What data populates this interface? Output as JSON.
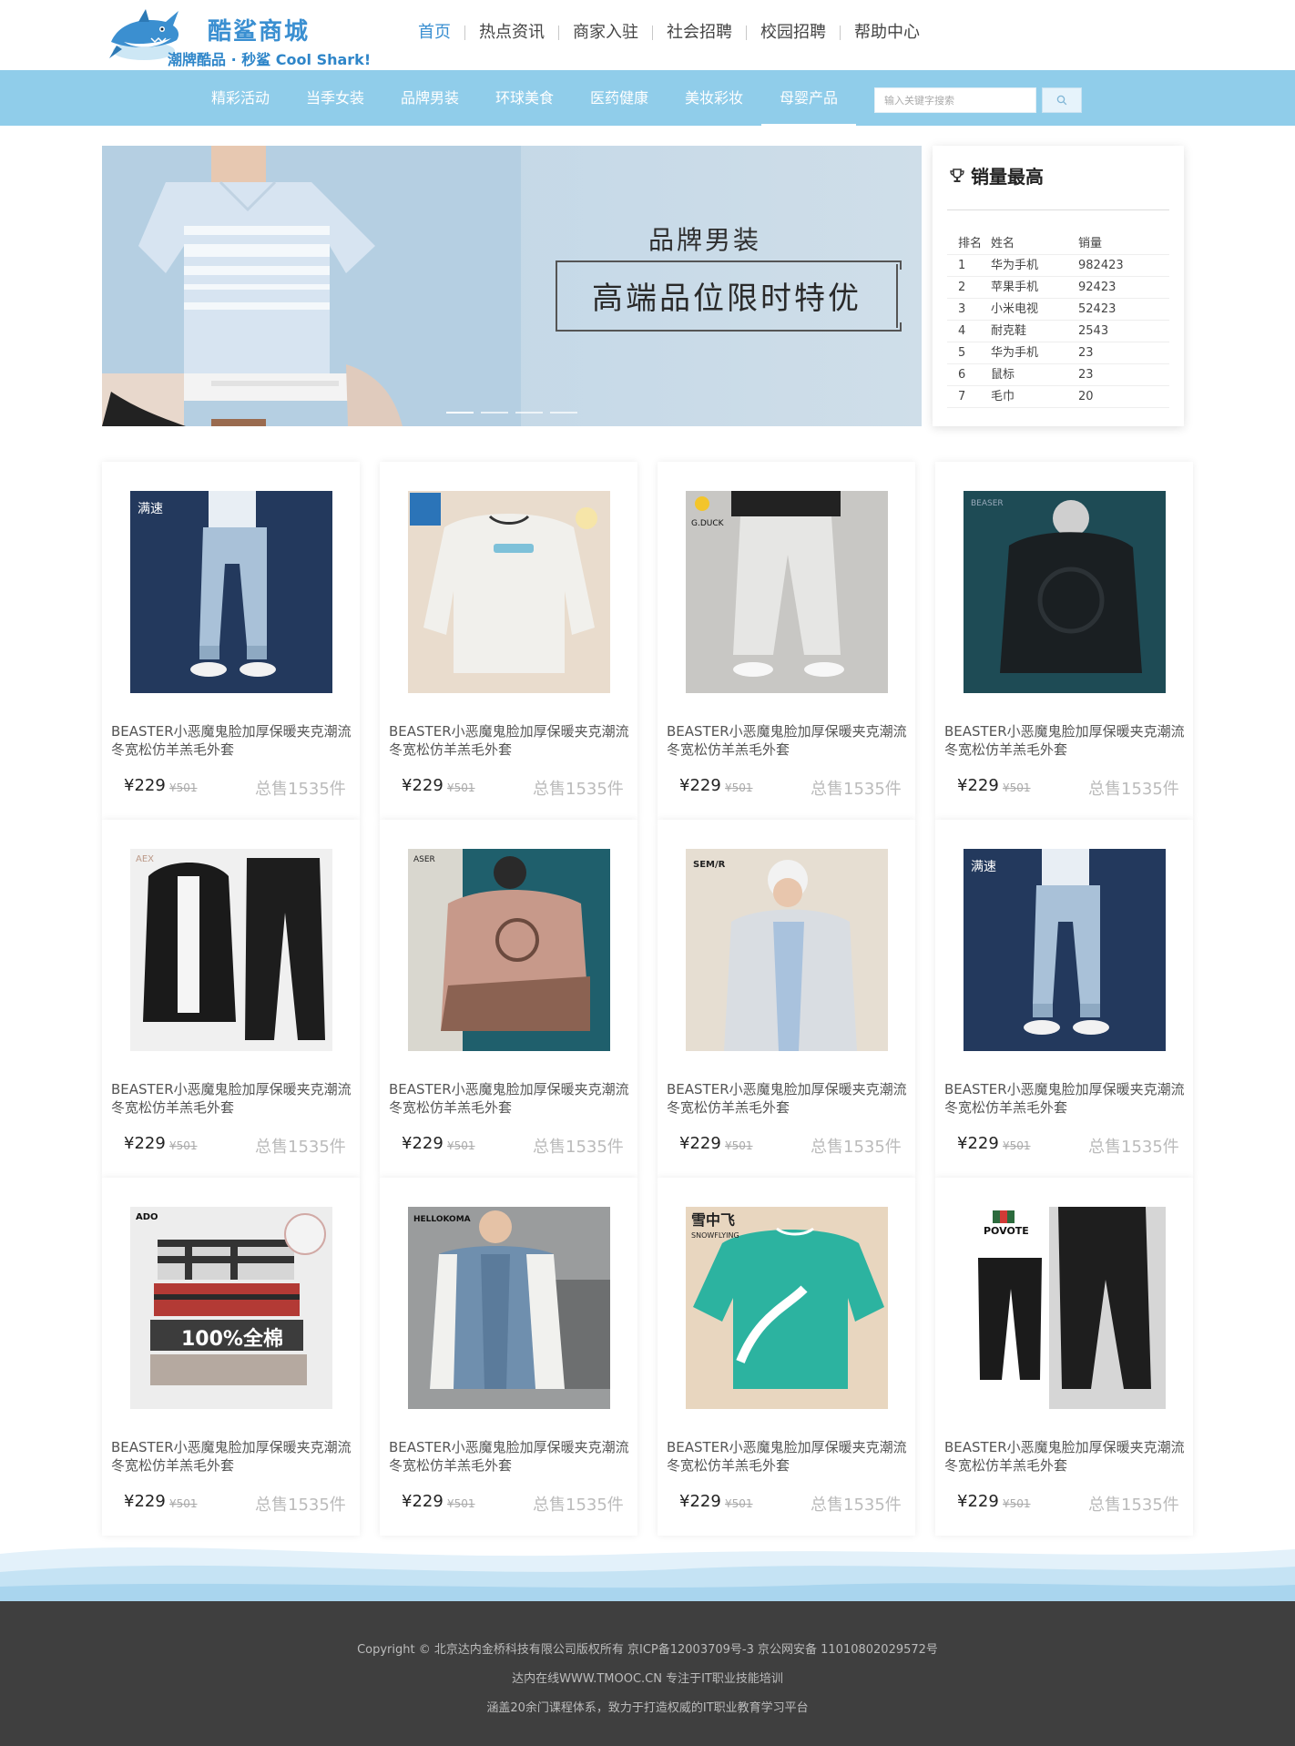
{
  "brand": {
    "name": "酷鲨商城",
    "slogan": "潮牌酷品 · 秒鲨 Cool Shark!"
  },
  "topnav": [
    {
      "label": "首页",
      "active": true
    },
    {
      "label": "热点资讯",
      "active": false
    },
    {
      "label": "商家入驻",
      "active": false
    },
    {
      "label": "社会招聘",
      "active": false
    },
    {
      "label": "校园招聘",
      "active": false
    },
    {
      "label": "帮助中心",
      "active": false
    }
  ],
  "categories": [
    {
      "label": "精彩活动",
      "active": false
    },
    {
      "label": "当季女装",
      "active": false
    },
    {
      "label": "品牌男装",
      "active": false
    },
    {
      "label": "环球美食",
      "active": false
    },
    {
      "label": "医药健康",
      "active": false
    },
    {
      "label": "美妆彩妆",
      "active": false
    },
    {
      "label": "母婴产品",
      "active": true
    }
  ],
  "search": {
    "placeholder": "输入关键字搜索"
  },
  "banner": {
    "title": "品牌男装",
    "subtitle": "高端品位限时特优",
    "slides": 4,
    "active_slide": 0
  },
  "ranking": {
    "title": "销量最高",
    "headers": [
      "排名",
      "姓名",
      "销量"
    ],
    "rows": [
      [
        "1",
        "华为手机",
        "982423"
      ],
      [
        "2",
        "苹果手机",
        "92423"
      ],
      [
        "3",
        "小米电视",
        "52423"
      ],
      [
        "4",
        "耐克鞋",
        "2543"
      ],
      [
        "5",
        "华为手机",
        "23"
      ],
      [
        "6",
        "鼠标",
        "23"
      ],
      [
        "7",
        "毛巾",
        "20"
      ]
    ]
  },
  "products": [
    {
      "name": "BEASTER小恶魔鬼脸加厚保暖夹克潮流冬宽松仿羊羔毛外套",
      "price": "¥229",
      "old_price": "¥501",
      "sold": "总售1535件",
      "image": "jeans-navy",
      "brand_mark": "满速"
    },
    {
      "name": "BEASTER小恶魔鬼脸加厚保暖夹克潮流冬宽松仿羊羔毛外套",
      "price": "¥229",
      "old_price": "¥501",
      "sold": "总售1535件",
      "image": "white-sweatshirt",
      "brand_mark": ""
    },
    {
      "name": "BEASTER小恶魔鬼脸加厚保暖夹克潮流冬宽松仿羊羔毛外套",
      "price": "¥229",
      "old_price": "¥501",
      "sold": "总售1535件",
      "image": "grey-joggers",
      "brand_mark": "G.DUCK"
    },
    {
      "name": "BEASTER小恶魔鬼脸加厚保暖夹克潮流冬宽松仿羊羔毛外套",
      "price": "¥229",
      "old_price": "¥501",
      "sold": "总售1535件",
      "image": "black-hoodie-teal",
      "brand_mark": "BEASER"
    },
    {
      "name": "BEASTER小恶魔鬼脸加厚保暖夹克潮流冬宽松仿羊羔毛外套",
      "price": "¥229",
      "old_price": "¥501",
      "sold": "总售1535件",
      "image": "black-tracksuit",
      "brand_mark": "AEX"
    },
    {
      "name": "BEASTER小恶魔鬼脸加厚保暖夹克潮流冬宽松仿羊羔毛外套",
      "price": "¥229",
      "old_price": "¥501",
      "sold": "总售1535件",
      "image": "pink-jacket",
      "brand_mark": "ASER"
    },
    {
      "name": "BEASTER小恶魔鬼脸加厚保暖夹克潮流冬宽松仿羊羔毛外套",
      "price": "¥229",
      "old_price": "¥501",
      "sold": "总售1535件",
      "image": "white-down-jacket",
      "brand_mark": "SEM/R"
    },
    {
      "name": "BEASTER小恶魔鬼脸加厚保暖夹克潮流冬宽松仿羊羔毛外套",
      "price": "¥229",
      "old_price": "¥501",
      "sold": "总售1535件",
      "image": "jeans-navy",
      "brand_mark": "满速"
    },
    {
      "name": "BEASTER小恶魔鬼脸加厚保暖夹克潮流冬宽松仿羊羔毛外套",
      "price": "¥229",
      "old_price": "¥501",
      "sold": "总售1535件",
      "image": "plaid-shirts",
      "brand_mark": "ADO",
      "badge": "100%全棉"
    },
    {
      "name": "BEASTER小恶魔鬼脸加厚保暖夹克潮流冬宽松仿羊羔毛外套",
      "price": "¥229",
      "old_price": "¥501",
      "sold": "总售1535件",
      "image": "varsity-jacket",
      "brand_mark": "HELLOKOMA"
    },
    {
      "name": "BEASTER小恶魔鬼脸加厚保暖夹克潮流冬宽松仿羊羔毛外套",
      "price": "¥229",
      "old_price": "¥501",
      "sold": "总售1535件",
      "image": "teal-tshirt",
      "brand_mark": "雪中飞",
      "sub_mark": "SNOWFLYING"
    },
    {
      "name": "BEASTER小恶魔鬼脸加厚保暖夹克潮流冬宽松仿羊羔毛外套",
      "price": "¥229",
      "old_price": "¥501",
      "sold": "总售1535件",
      "image": "black-pants",
      "brand_mark": "POVOTE"
    }
  ],
  "footer": {
    "line1": "Copyright © 北京达内金桥科技有限公司版权所有 京ICP备12003709号-3 京公网安备 11010802029572号",
    "line2": "达内在线WWW.TMOOC.CN 专注于IT职业技能培训",
    "line3": "涵盖20余门课程体系，致力于打造权威的IT职业教育学习平台"
  },
  "colors": {
    "accent": "#3a8fd1",
    "catbar": "#90cdea",
    "footer": "#3f3f3f"
  }
}
